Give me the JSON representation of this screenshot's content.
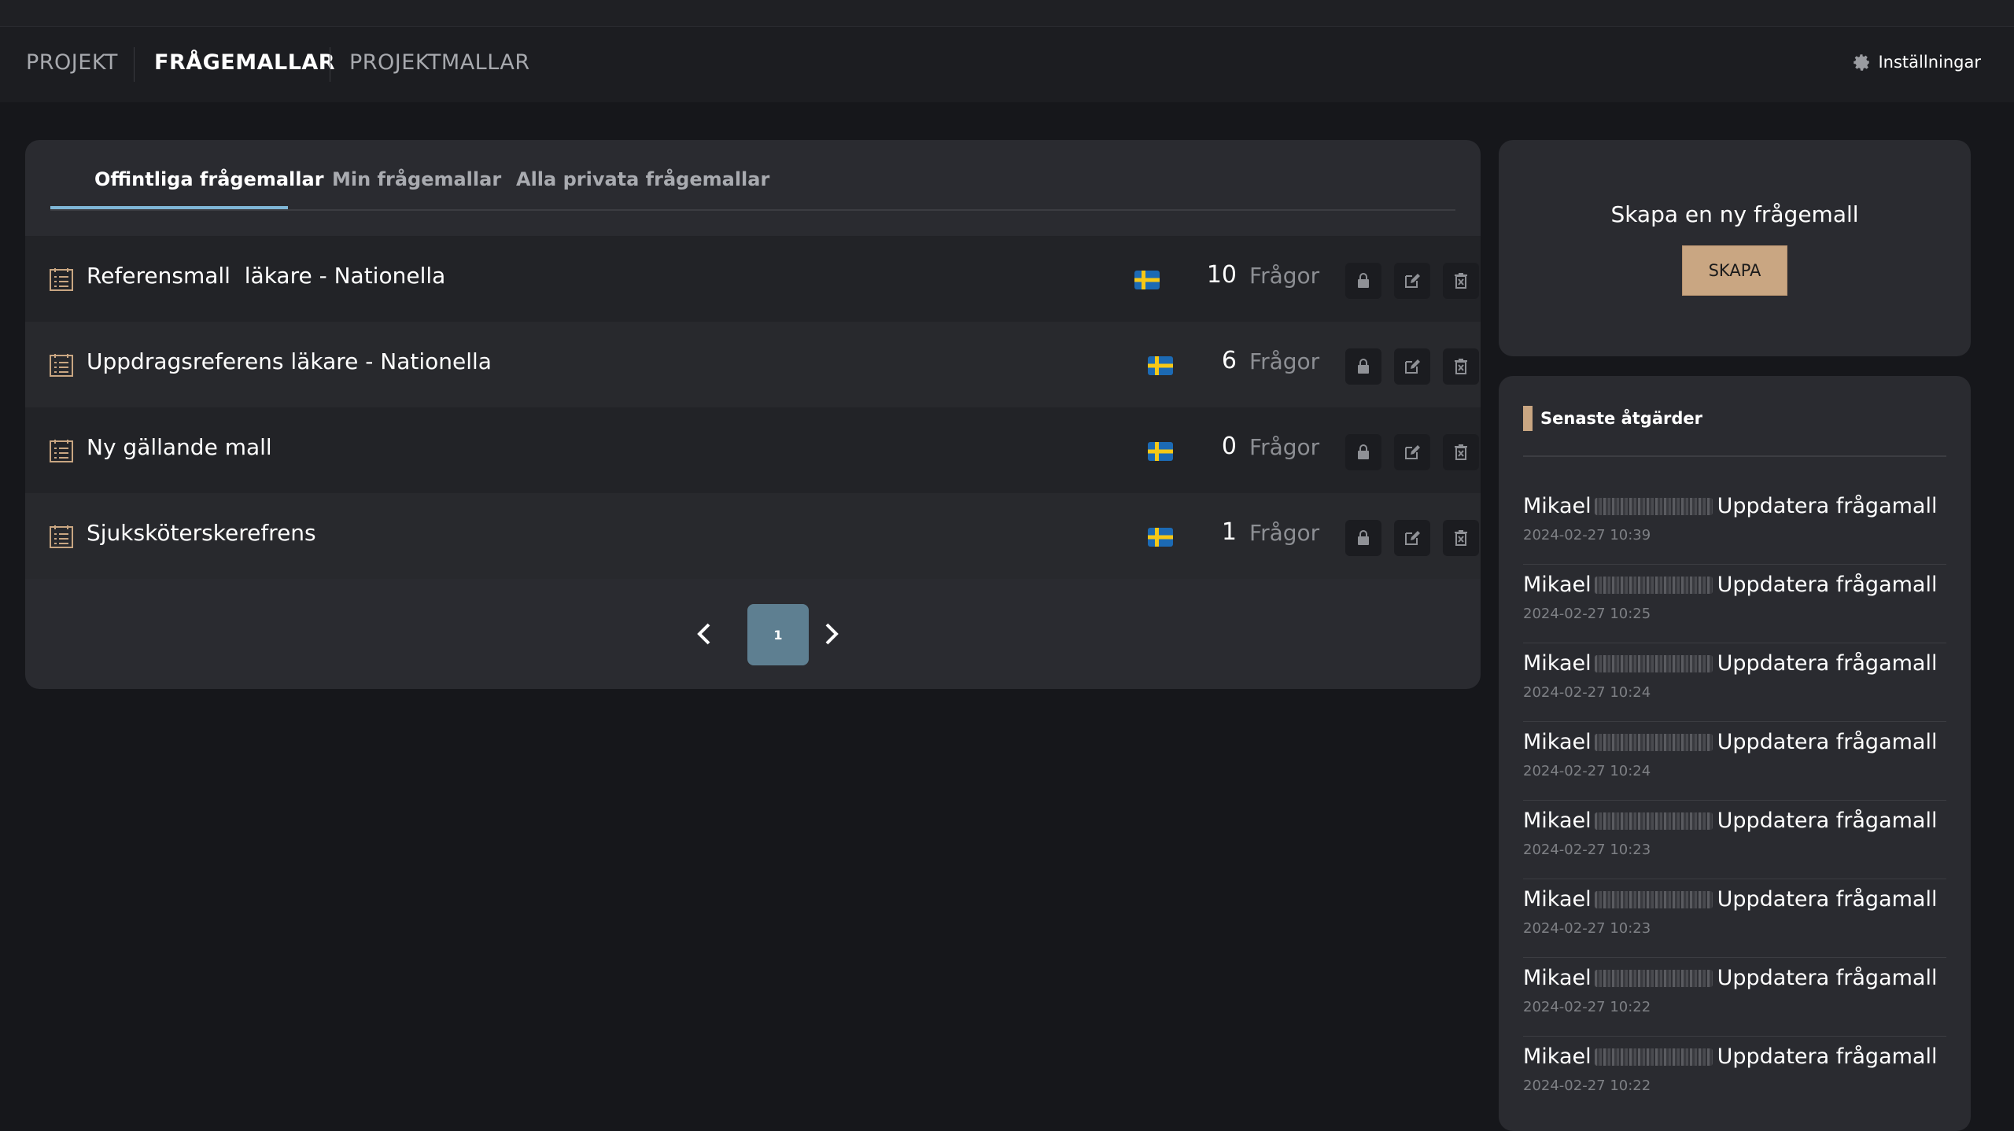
{
  "nav": {
    "items": [
      "PROJEKT",
      "FRÅGEMALLAR",
      "PROJEKTMALLAR"
    ],
    "settings_label": "Inställningar"
  },
  "tabs": [
    "Offintliga frågemallar",
    "Min frågemallar",
    "Alla privata frågemallar"
  ],
  "templates": [
    {
      "title": "Referensmall  läkare - Nationella",
      "count": "10",
      "unit": "Frågor",
      "flag": "sweden-flag-icon"
    },
    {
      "title": "Uppdragsreferens läkare - Nationella",
      "count": "6",
      "unit": "Frågor",
      "flag": "sweden-flag-icon"
    },
    {
      "title": "Ny gällande mall",
      "count": "0",
      "unit": "Frågor",
      "flag": "sweden-flag-icon"
    },
    {
      "title": "Sjuksköterskerefrens",
      "count": "1",
      "unit": "Frågor",
      "flag": "sweden-flag-icon"
    }
  ],
  "pager": {
    "current": "1"
  },
  "create": {
    "title": "Skapa en ny frågemall",
    "button": "SKAPA"
  },
  "recent": {
    "title": "Senaste åtgärder",
    "entries": [
      {
        "user": "Mikael",
        "action": "Uppdatera frågamall",
        "time": "2024-02-27 10:39"
      },
      {
        "user": "Mikael",
        "action": "Uppdatera frågamall",
        "time": "2024-02-27 10:25"
      },
      {
        "user": "Mikael",
        "action": "Uppdatera frågamall",
        "time": "2024-02-27 10:24"
      },
      {
        "user": "Mikael",
        "action": "Uppdatera frågamall",
        "time": "2024-02-27 10:24"
      },
      {
        "user": "Mikael",
        "action": "Uppdatera frågamall",
        "time": "2024-02-27 10:23"
      },
      {
        "user": "Mikael",
        "action": "Uppdatera frågamall",
        "time": "2024-02-27 10:23"
      },
      {
        "user": "Mikael",
        "action": "Uppdatera frågamall",
        "time": "2024-02-27 10:22"
      },
      {
        "user": "Mikael",
        "action": "Uppdatera frågamall",
        "time": "2024-02-27 10:22"
      }
    ]
  },
  "colors": {
    "accent": "#c9a682",
    "tab_underline": "#7fb6d6",
    "page_current": "#5e7f91"
  }
}
